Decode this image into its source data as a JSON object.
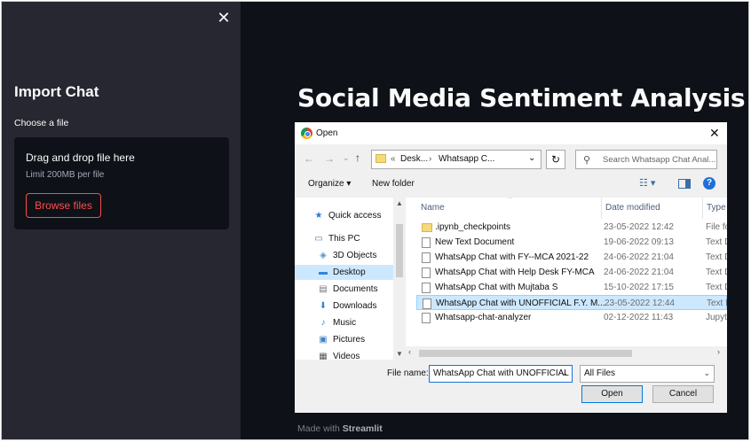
{
  "sidebar": {
    "close_glyph": "✕",
    "title": "Import Chat",
    "choose_label": "Choose a file",
    "dropzone": {
      "title": "Drag and drop file here",
      "limit": "Limit 200MB per file",
      "browse_label": "Browse files"
    }
  },
  "main": {
    "title": "Social Media Sentiment Analysis",
    "footer_prefix": "Made with",
    "footer_brand": "Streamlit"
  },
  "dialog": {
    "title": "Open",
    "close_glyph": "✕",
    "path": {
      "prefix": "«",
      "segments": [
        "Desk...",
        "Whatsapp C..."
      ],
      "separator": "›"
    },
    "search_placeholder": "Search Whatsapp Chat Anal...",
    "toolbar": {
      "organize": "Organize ▾",
      "new_folder": "New folder"
    },
    "nav": [
      {
        "label": "Quick access",
        "icon": "star-icon"
      },
      {
        "label": "This PC",
        "icon": "pc-icon"
      },
      {
        "label": "3D Objects",
        "icon": "cube-icon"
      },
      {
        "label": "Desktop",
        "icon": "desktop-icon",
        "selected": true
      },
      {
        "label": "Documents",
        "icon": "document-icon"
      },
      {
        "label": "Downloads",
        "icon": "download-icon"
      },
      {
        "label": "Music",
        "icon": "music-icon"
      },
      {
        "label": "Pictures",
        "icon": "picture-icon"
      },
      {
        "label": "Videos",
        "icon": "video-icon"
      }
    ],
    "columns": {
      "name": "Name",
      "date": "Date modified",
      "type": "Type"
    },
    "files": [
      {
        "name": ".ipynb_checkpoints",
        "date": "23-05-2022 12:42",
        "type": "File fo",
        "kind": "folder"
      },
      {
        "name": "New Text Document",
        "date": "19-06-2022 09:13",
        "type": "Text D",
        "kind": "file"
      },
      {
        "name": "WhatsApp Chat with FY--MCA 2021-22",
        "date": "24-06-2022 21:04",
        "type": "Text D",
        "kind": "file"
      },
      {
        "name": "WhatsApp Chat with Help Desk FY-MCA",
        "date": "24-06-2022 21:04",
        "type": "Text D",
        "kind": "file"
      },
      {
        "name": "WhatsApp Chat with Mujtaba S",
        "date": "15-10-2022 17:15",
        "type": "Text D",
        "kind": "file"
      },
      {
        "name": "WhatsApp Chat with UNOFFICIAL F.Y. M...",
        "date": "23-05-2022 12:44",
        "type": "Text D",
        "kind": "file",
        "selected": true
      },
      {
        "name": "Whatsapp-chat-analyzer",
        "date": "02-12-2022 11:43",
        "type": "Jupyt",
        "kind": "file"
      }
    ],
    "file_name_label": "File name:",
    "file_name_value": "WhatsApp Chat with UNOFFICIAL",
    "file_type_value": "All Files",
    "open_label": "Open",
    "cancel_label": "Cancel"
  },
  "colors": {
    "app_bg": "#0e1117",
    "sidebar_bg": "#262730",
    "accent": "#ff4b4b",
    "selection": "#cce8ff"
  }
}
